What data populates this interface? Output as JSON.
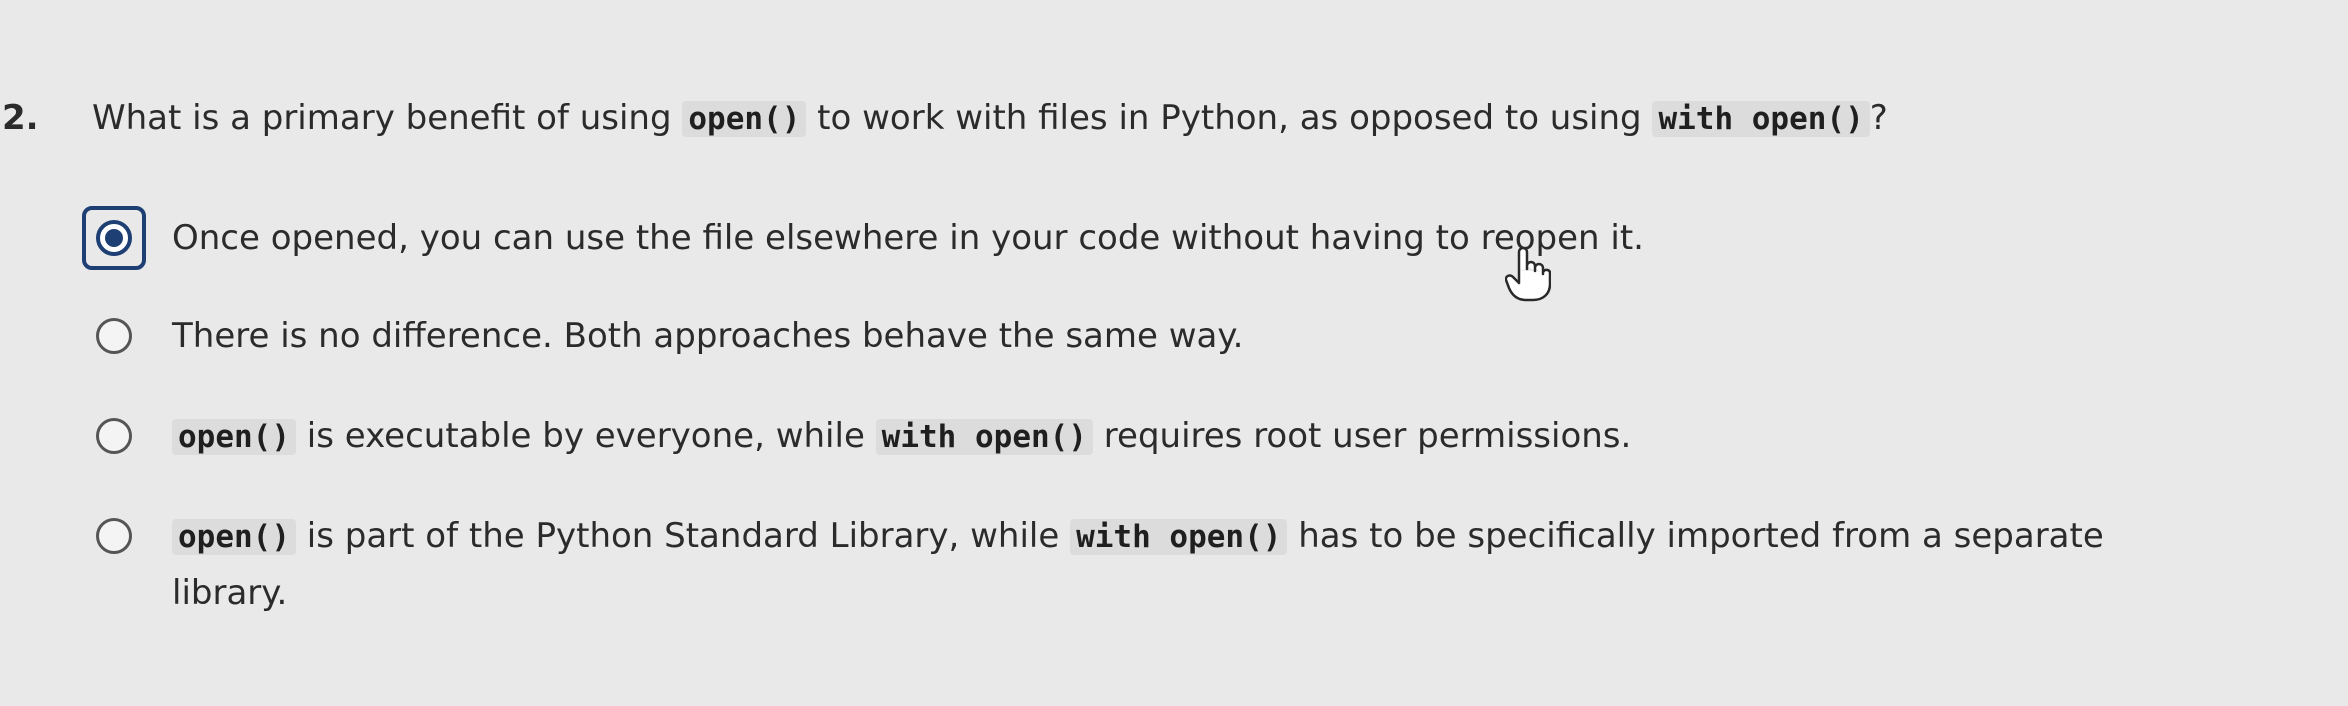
{
  "question": {
    "number": "2.",
    "text_before": "What is a primary benefit of using",
    "code1": "open()",
    "text_middle": "to work with files in Python, as opposed to using",
    "code2": "with open()",
    "text_after": "?"
  },
  "options": [
    {
      "selected": true,
      "text": "Once opened, you can use the file elsewhere in your code without having to reopen it."
    },
    {
      "selected": false,
      "text": "There is no difference. Both approaches behave the same way."
    },
    {
      "selected": false,
      "code1": "open()",
      "text_middle": "is executable by everyone, while",
      "code2": "with open()",
      "text_after": "requires root user permissions."
    },
    {
      "selected": false,
      "code1": "open()",
      "text_middle": "is part of the Python Standard Library, while",
      "code2": "with open()",
      "text_after": "has to be specifically imported from a separate library."
    }
  ],
  "icons": {
    "cursor": "hand-pointer-icon",
    "radio_selected": "radio-selected-icon",
    "radio_unselected": "radio-unselected-icon"
  },
  "colors": {
    "background": "#e9e9e9",
    "text": "#2b2b2b",
    "selected": "#1d3f73",
    "code_background": "#dcdcdc"
  }
}
